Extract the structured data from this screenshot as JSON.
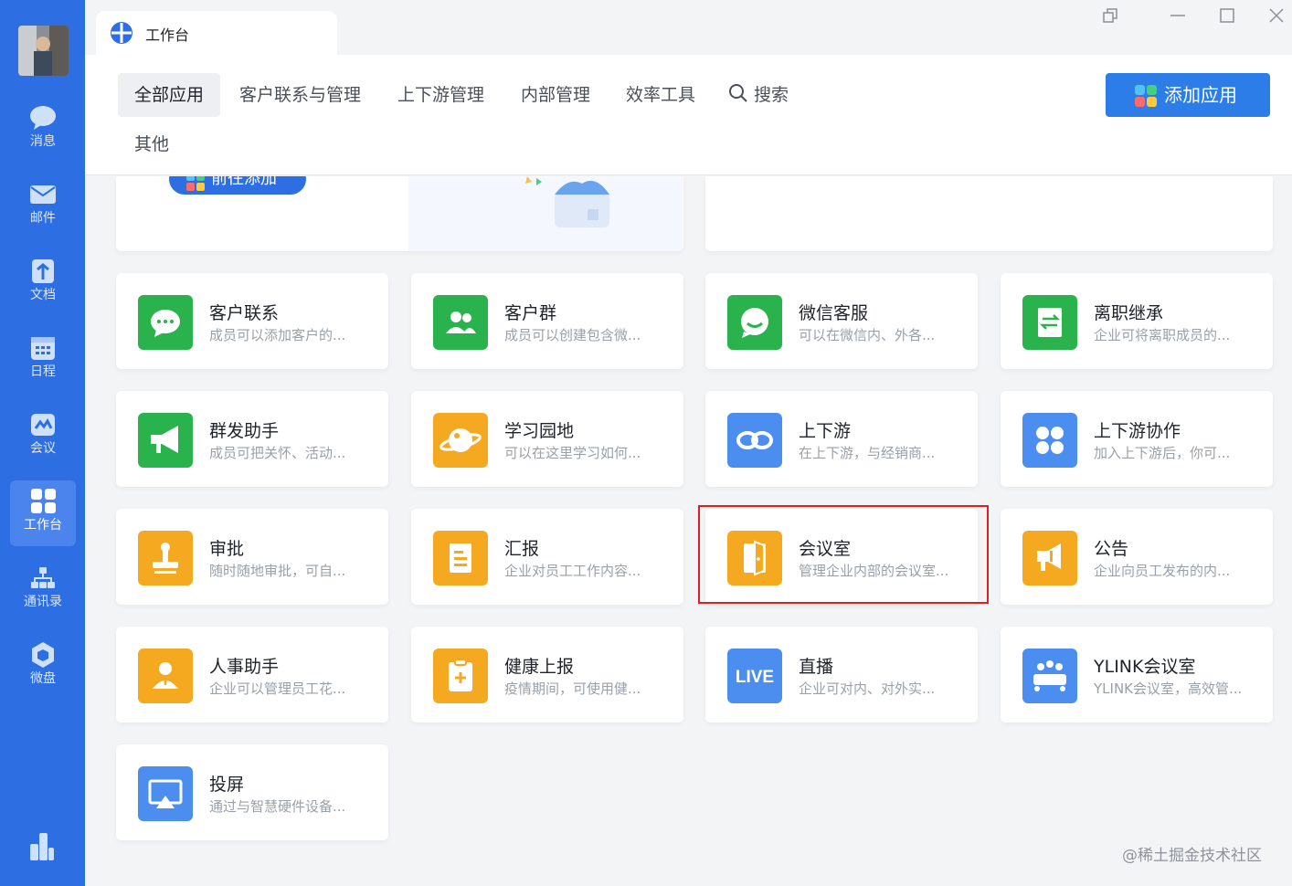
{
  "window": {
    "tab_title": "工作台",
    "controls": [
      "restore-icon",
      "minimize-icon",
      "maximize-icon",
      "close-icon"
    ]
  },
  "sidebar": {
    "items": [
      {
        "label": "消息",
        "icon": "message-icon"
      },
      {
        "label": "邮件",
        "icon": "mail-icon"
      },
      {
        "label": "文档",
        "icon": "doc-icon"
      },
      {
        "label": "日程",
        "icon": "calendar-icon"
      },
      {
        "label": "会议",
        "icon": "meeting-icon"
      },
      {
        "label": "工作台",
        "icon": "workbench-icon",
        "active": true
      },
      {
        "label": "通讯录",
        "icon": "contacts-icon"
      },
      {
        "label": "微盘",
        "icon": "drive-icon"
      }
    ]
  },
  "header": {
    "categories": [
      "全部应用",
      "客户联系与管理",
      "上下游管理",
      "内部管理",
      "效率工具"
    ],
    "search_label": "搜索",
    "other_label": "其他",
    "add_button": "添加应用"
  },
  "banner": {
    "button_label": "前往添加"
  },
  "apps": [
    {
      "name": "客户联系",
      "desc": "成员可以添加客户的...",
      "color": "#2ab24c",
      "icon": "chat-bubble-icon"
    },
    {
      "name": "客户群",
      "desc": "成员可以创建包含微...",
      "color": "#2ab24c",
      "icon": "group-users-icon"
    },
    {
      "name": "微信客服",
      "desc": "可以在微信内、外各...",
      "color": "#2ab24c",
      "icon": "wechat-service-icon"
    },
    {
      "name": "离职继承",
      "desc": "企业可将离职成员的...",
      "color": "#2ab24c",
      "icon": "transfer-doc-icon"
    },
    {
      "name": "群发助手",
      "desc": "成员可把关怀、活动...",
      "color": "#2ab24c",
      "icon": "megaphone-icon"
    },
    {
      "name": "学习园地",
      "desc": "可以在这里学习如何...",
      "color": "#f5a921",
      "icon": "planet-icon"
    },
    {
      "name": "上下游",
      "desc": "在上下游，与经销商...",
      "color": "#4b8ef0",
      "icon": "link-icon"
    },
    {
      "name": "上下游协作",
      "desc": "加入上下游后，你可...",
      "color": "#4b8ef0",
      "icon": "apps-grid-icon"
    },
    {
      "name": "审批",
      "desc": "随时随地审批，可自...",
      "color": "#f5a921",
      "icon": "stamp-icon"
    },
    {
      "name": "汇报",
      "desc": "企业对员工工作内容...",
      "color": "#f5a921",
      "icon": "report-icon"
    },
    {
      "name": "会议室",
      "desc": "管理企业内部的会议室...",
      "color": "#f5a921",
      "icon": "door-icon"
    },
    {
      "name": "公告",
      "desc": "企业向员工发布的内...",
      "color": "#f5a921",
      "icon": "announcement-icon"
    },
    {
      "name": "人事助手",
      "desc": "企业可以管理员工花...",
      "color": "#f5a921",
      "icon": "hr-person-icon"
    },
    {
      "name": "健康上报",
      "desc": "疫情期间，可使用健...",
      "color": "#f5a921",
      "icon": "health-clipboard-icon"
    },
    {
      "name": "直播",
      "desc": "企业可对内、对外实...",
      "color": "#4b8ef0",
      "icon": "live-icon",
      "badge": "LIVE"
    },
    {
      "name": "YLINK会议室",
      "desc": "YLINK会议室，高效管...",
      "color": "#4b8ef0",
      "icon": "conference-icon"
    },
    {
      "name": "投屏",
      "desc": "通过与智慧硬件设备...",
      "color": "#4b8ef0",
      "icon": "screen-cast-icon"
    }
  ],
  "watermark": "@稀土掘金技术社区"
}
